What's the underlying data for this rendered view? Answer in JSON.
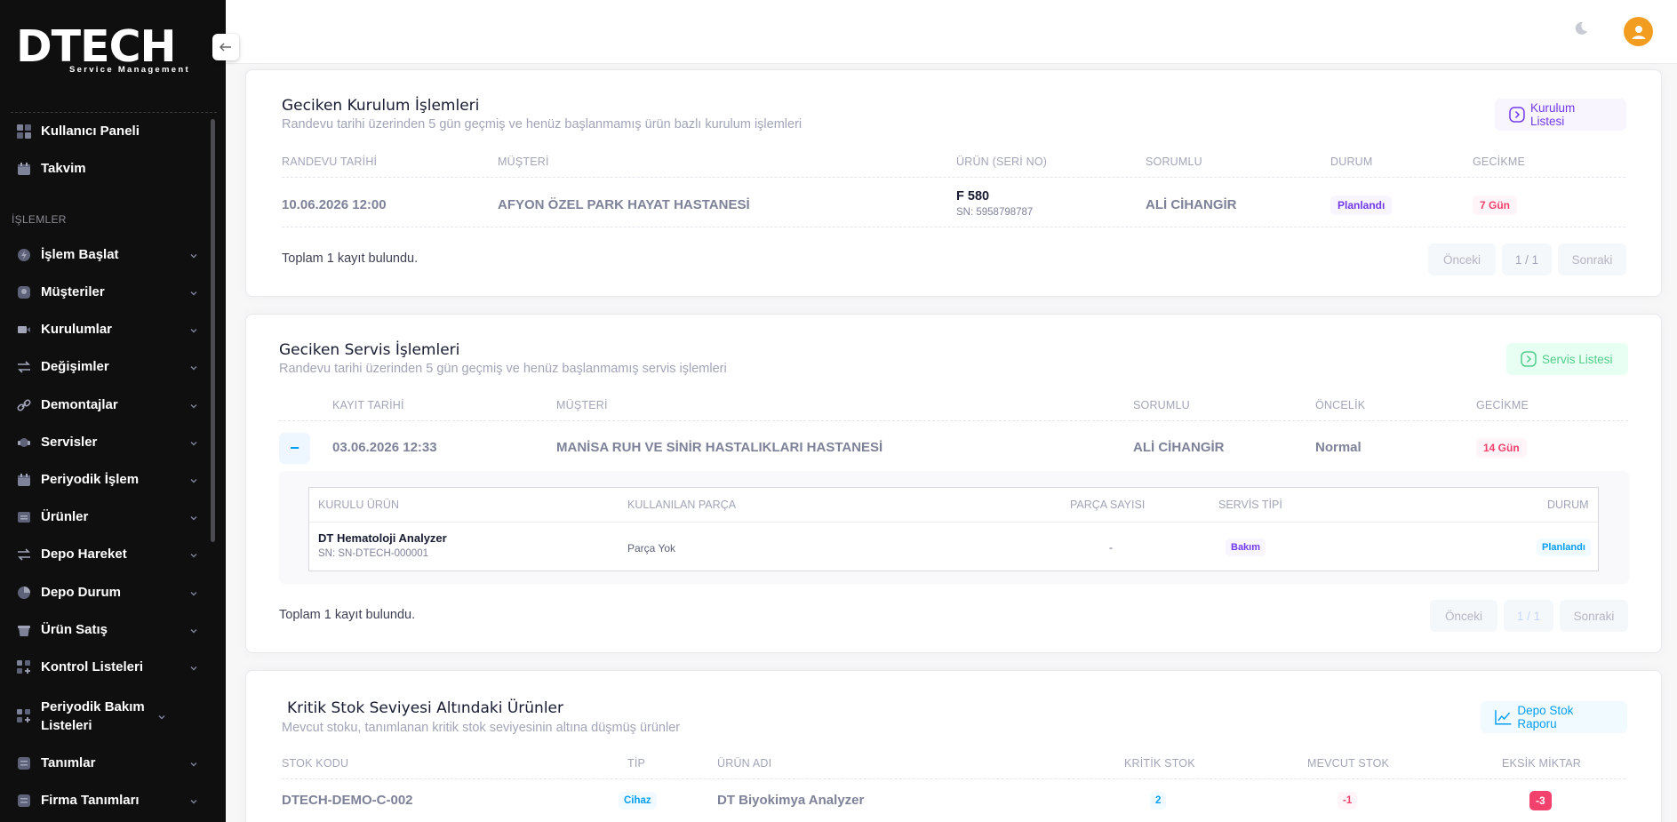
{
  "brand": {
    "logo": "DTECH",
    "tagline": "Service Management"
  },
  "sidebar": {
    "section_label": "İŞLEMLER",
    "top_items": [
      {
        "label": "Kullanıcı Paneli",
        "icon": "dashboard-icon"
      },
      {
        "label": "Takvim",
        "icon": "calendar-icon"
      }
    ],
    "items": [
      {
        "label": "İşlem Başlat",
        "icon": "bolt-icon"
      },
      {
        "label": "Müşteriler",
        "icon": "user-icon"
      },
      {
        "label": "Kurulumlar",
        "icon": "video-icon"
      },
      {
        "label": "Değişimler",
        "icon": "swap-icon"
      },
      {
        "label": "Demontajlar",
        "icon": "link-icon"
      },
      {
        "label": "Servisler",
        "icon": "headset-icon"
      },
      {
        "label": "Periyodik İşlem",
        "icon": "calendar-icon"
      },
      {
        "label": "Ürünler",
        "icon": "box-icon"
      },
      {
        "label": "Depo Hareket",
        "icon": "swap-icon"
      },
      {
        "label": "Depo Durum",
        "icon": "pie-chart-icon"
      },
      {
        "label": "Ürün Satış",
        "icon": "basket-icon"
      },
      {
        "label": "Kontrol Listeleri",
        "icon": "grid-plus-icon"
      },
      {
        "label": "Periyodik Bakım Listeleri",
        "icon": "grid-plus-icon"
      },
      {
        "label": "Tanımlar",
        "icon": "list-icon"
      },
      {
        "label": "Firma Tanımları",
        "icon": "list-icon"
      }
    ]
  },
  "installs": {
    "title": "Geciken Kurulum İşlemleri",
    "subtitle": "Randevu tarihi üzerinden 5 gün geçmiş ve henüz başlanmamış ürün bazlı kurulum işlemleri",
    "button": "Kurulum Listesi",
    "headers": [
      "RANDEVU TARİHİ",
      "MÜŞTERİ",
      "ÜRÜN (SERİ NO)",
      "SORUMLU",
      "DURUM",
      "GECİKME"
    ],
    "row": {
      "date": "10.06.2026 12:00",
      "customer": "AFYON ÖZEL PARK HAYAT HASTANESİ",
      "product": "F 580",
      "serial": "SN: 5958798787",
      "owner": "ALİ CİHANGİR",
      "status": "Planlandı",
      "delay": "7 Gün"
    },
    "footer": "Toplam 1 kayıt bulundu.",
    "pager": {
      "prev": "Önceki",
      "page": "1 / 1",
      "next": "Sonraki"
    }
  },
  "services": {
    "title": "Geciken Servis İşlemleri",
    "subtitle": "Randevu tarihi üzerinden 5 gün geçmiş ve henüz başlanmamış servis işlemleri",
    "button": "Servis Listesi",
    "headers": [
      "KAYIT TARİHİ",
      "MÜŞTERİ",
      "SORUMLU",
      "ÖNCELİK",
      "GECİKME"
    ],
    "row": {
      "toggle": "−",
      "date": "03.06.2026 12:33",
      "customer": "MANİSA RUH VE SİNİR HASTALIKLARI HASTANESİ",
      "owner": "ALİ CİHANGİR",
      "priority": "Normal",
      "delay": "14 Gün"
    },
    "detail": {
      "headers": [
        "KURULU ÜRÜN",
        "KULLANILAN PARÇA",
        "PARÇA SAYISI",
        "SERVİS TİPİ",
        "DURUM"
      ],
      "product": "DT Hematoloji Analyzer",
      "serial": "SN: SN-DTECH-000001",
      "part": "Parça Yok",
      "part_count": "-",
      "service_type": "Bakım",
      "status": "Planlandı"
    },
    "footer": "Toplam 1 kayıt bulundu.",
    "pager": {
      "prev": "Önceki",
      "page": "1 / 1",
      "next": "Sonraki"
    }
  },
  "stock": {
    "title": "Kritik Stok Seviyesi Altındaki Ürünler",
    "subtitle": "Mevcut stoku, tanımlanan kritik stok seviyesinin altına düşmüş ürünler",
    "button": "Depo Stok Raporu",
    "headers": [
      "STOK KODU",
      "TİP",
      "ÜRÜN ADI",
      "KRİTİK STOK",
      "MEVCUT STOK",
      "EKSİK MİKTAR"
    ],
    "row": {
      "code": "DTECH-DEMO-C-002",
      "type": "Cihaz",
      "name": "DT Biyokimya Analyzer",
      "critical": "2",
      "current": "-1",
      "missing": "-3"
    }
  },
  "colors": {
    "purple": "#7239ea",
    "green": "#50cd89",
    "blue": "#009ef7",
    "red": "#f1416c",
    "avatar": "#f29d1f"
  }
}
